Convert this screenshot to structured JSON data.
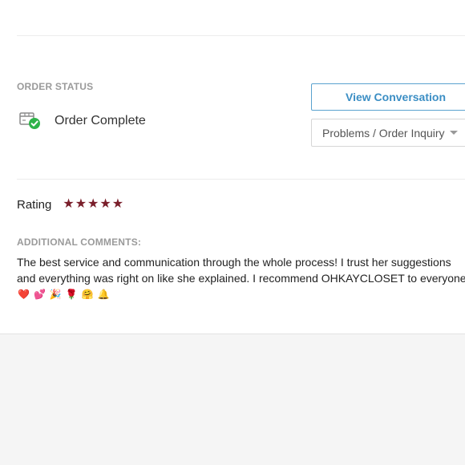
{
  "order_status": {
    "label": "ORDER STATUS",
    "value": "Order Complete",
    "icon": "package-check-icon"
  },
  "actions": {
    "view_conversation_label": "View Conversation",
    "inquiry_select_value": "Problems / Order Inquiry"
  },
  "rating": {
    "label": "Rating",
    "stars": 5,
    "max_stars": 5,
    "star_color": "#7a1f2b"
  },
  "comments": {
    "label": "ADDITIONAL COMMENTS:",
    "line1": "The best service and communication through the whole process! I trust her suggestions",
    "line2": "and everything was right on like she explained. I recommend OHKAYCLOSET to everyone!",
    "emojis": [
      "❤️",
      "💕",
      "🎉",
      "🌹",
      "🤗",
      "🔔"
    ]
  },
  "colors": {
    "accent": "#3b8ec4",
    "success": "#2fb34a"
  }
}
